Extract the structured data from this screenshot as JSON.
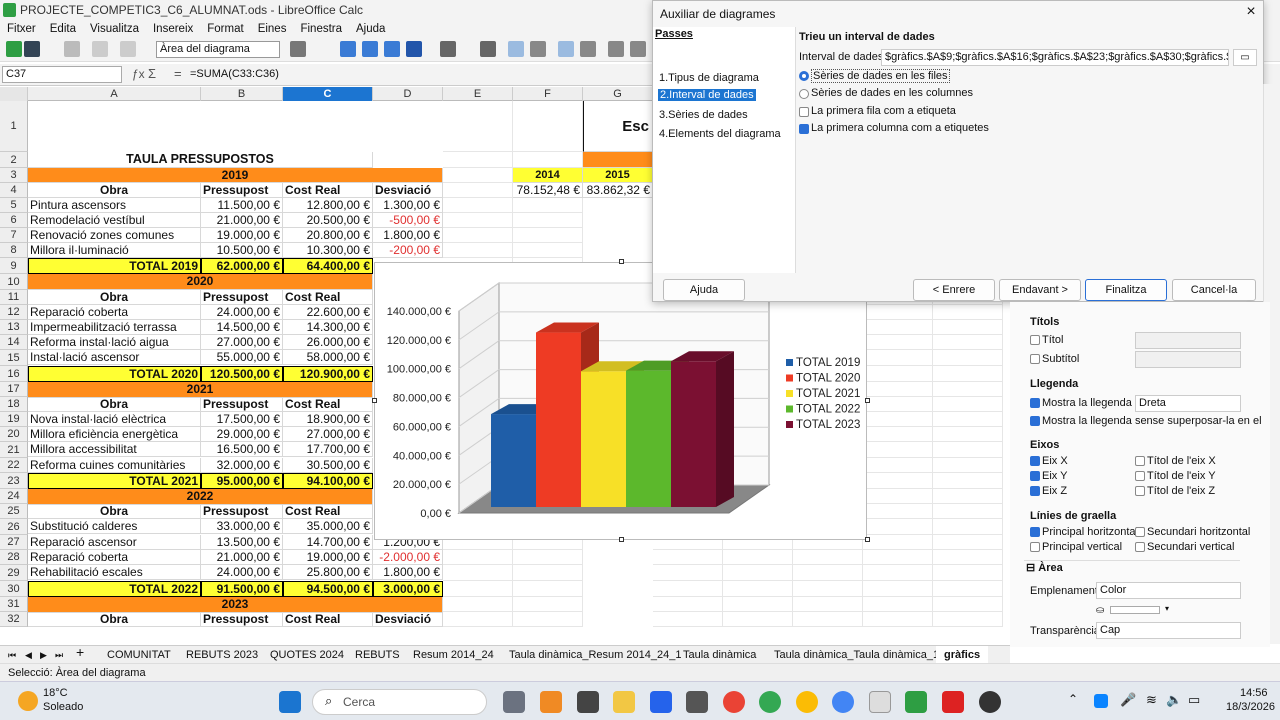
{
  "window": {
    "title": "PROJECTE_COMPETIC3_C6_ALUMNAT.ods - LibreOffice Calc"
  },
  "menu": [
    "Fitxer",
    "Edita",
    "Visualitza",
    "Insereix",
    "Format",
    "Eines",
    "Finestra",
    "Ajuda"
  ],
  "toolbar": {
    "object_select": "Àrea del diagrama"
  },
  "formula_bar": {
    "cell": "C37",
    "formula": "=SUMA(C33:C36)"
  },
  "columns": [
    "A",
    "B",
    "C",
    "D",
    "E",
    "F",
    "G"
  ],
  "rows": [
    "1",
    "2",
    "3",
    "4",
    "5",
    "6",
    "7",
    "8",
    "9",
    "10",
    "11",
    "12",
    "13",
    "14",
    "15",
    "16",
    "17",
    "18",
    "19",
    "20",
    "21",
    "22",
    "23",
    "24",
    "25",
    "26",
    "27",
    "28",
    "29",
    "30",
    "31",
    "32"
  ],
  "sheet": {
    "title": "TAULA PRESSUPOSTOS",
    "esc_fragment": "Esc",
    "yr_headers": [
      "2014",
      "2015"
    ],
    "yr_values": [
      "78.152,48 €",
      "83.862,32 €"
    ],
    "hdr_obra": "Obra",
    "hdr_pressupost": "Pressupost",
    "hdr_cost": "Cost Real",
    "hdr_desviacio": "Desviació",
    "y2019": "2019",
    "y2020": "2020",
    "y2021": "2021",
    "y2022": "2022",
    "y2023": "2023",
    "r5": [
      "Pintura ascensors",
      "11.500,00 €",
      "12.800,00 €",
      "1.300,00 €"
    ],
    "r6": [
      "Remodelació vestíbul",
      "21.000,00 €",
      "20.500,00 €",
      "-500,00 €"
    ],
    "r7": [
      "Renovació zones comunes",
      "19.000,00 €",
      "20.800,00 €",
      "1.800,00 €"
    ],
    "r8": [
      "Millora il·luminació",
      "10.500,00 €",
      "10.300,00 €",
      "-200,00 €"
    ],
    "r9": [
      "TOTAL 2019",
      "62.000,00 €",
      "64.400,00 €"
    ],
    "r12": [
      "Reparació coberta",
      "24.000,00 €",
      "22.600,00 €"
    ],
    "r13": [
      "Impermeabilització terrassa",
      "14.500,00 €",
      "14.300,00 €"
    ],
    "r14": [
      "Reforma instal·lació aigua",
      "27.000,00 €",
      "26.000,00 €"
    ],
    "r15": [
      "Instal·lació ascensor",
      "55.000,00 €",
      "58.000,00 €"
    ],
    "r16": [
      "TOTAL 2020",
      "120.500,00 €",
      "120.900,00 €"
    ],
    "r19": [
      "Nova instal·lació elèctrica",
      "17.500,00 €",
      "18.900,00 €"
    ],
    "r20": [
      "Millora eficiència energètica",
      "29.000,00 €",
      "27.000,00 €"
    ],
    "r21": [
      "Millora accessibilitat",
      "16.500,00 €",
      "17.700,00 €"
    ],
    "r22": [
      "Reforma cuines comunitàries",
      "32.000,00 €",
      "30.500,00 €"
    ],
    "r23": [
      "TOTAL 2021",
      "95.000,00 €",
      "94.100,00 €"
    ],
    "r26": [
      "Substitució calderes",
      "33.000,00 €",
      "35.000,00 €"
    ],
    "r27": [
      "Reparació ascensor",
      "13.500,00 €",
      "14.700,00 €",
      "1.200,00 €"
    ],
    "r28": [
      "Reparació coberta",
      "21.000,00 €",
      "19.000,00 €",
      "-2.000,00 €"
    ],
    "r29": [
      "Rehabilitació escales",
      "24.000,00 €",
      "25.800,00 €",
      "1.800,00 €"
    ],
    "r30": [
      "TOTAL 2022",
      "91.500,00 €",
      "94.500,00 €",
      "3.000,00 €"
    ]
  },
  "chart_data": {
    "type": "bar",
    "categories": [
      "TOTAL 2019",
      "TOTAL 2020",
      "TOTAL 2021",
      "TOTAL 2022",
      "TOTAL 2023"
    ],
    "values": [
      64400,
      120900,
      94100,
      94500,
      101000
    ],
    "colors": [
      "#1f5ea8",
      "#ee3b24",
      "#f7e027",
      "#5cb82c",
      "#7b1032"
    ],
    "ylim": [
      0,
      140000
    ],
    "yticks": [
      "0,00 €",
      "20.000,00 €",
      "40.000,00 €",
      "60.000,00 €",
      "80.000,00 €",
      "100.000,00 €",
      "120.000,00 €",
      "140.000,00 €"
    ],
    "legend": "right",
    "grid": true,
    "style": "3d"
  },
  "dialog": {
    "title": "Auxiliar de diagrames",
    "steps_title": "Passes",
    "steps": [
      "1.Tipus de diagrama",
      "2.Interval de dades",
      "3.Sèries de dades",
      "4.Elements del diagrama"
    ],
    "heading": "Trieu un interval de dades",
    "range_label": "Interval de dades:",
    "range_value": "$gràfics.$A$9;$gràfics.$A$16;$gràfics.$A$23;$gràfics.$A$30;$gràfics.$A$37;$grà",
    "radio_rows": "Sèries de dades en les files",
    "radio_cols": "Sèries de dades en les columnes",
    "chk_first_row": "La primera fila com a etiqueta",
    "chk_first_col": "La primera columna com a etiquetes",
    "btn_help": "Ajuda",
    "btn_back": "< Enrere",
    "btn_next": "Endavant >",
    "btn_finish": "Finalitza",
    "btn_cancel": "Cancel·la"
  },
  "sidebar": {
    "sec_titles": "Títols",
    "titol": "Títol",
    "subtitol": "Subtítol",
    "sec_legend": "Llegenda",
    "show_legend": "Mostra la llegenda",
    "legend_pos": "Dreta",
    "legend_nooverlap": "Mostra la llegenda sense superposar-la en el",
    "sec_axes": "Eixos",
    "ax_x": "Eix X",
    "ax_y": "Eix Y",
    "ax_z": "Eix Z",
    "t_x": "Títol de l'eix X",
    "t_y": "Títol de l'eix Y",
    "t_z": "Títol de l'eix Z",
    "sec_grid": "Línies de graella",
    "g_ph": "Principal horitzontal",
    "g_sh": "Secundari horitzontal",
    "g_pv": "Principal vertical",
    "g_sv": "Secundari vertical",
    "sec_area": "Àrea",
    "fill_label": "Emplenament:",
    "fill_value": "Color",
    "transp_label": "Transparència:",
    "transp_value": "Cap"
  },
  "tabs": [
    "COMUNITAT",
    "REBUTS 2023",
    "QUOTES 2024",
    "REBUTS",
    "Resum 2014_24",
    "Taula dinàmica_Resum 2014_24_1",
    "Taula dinàmica",
    "Taula dinàmica_Taula dinàmica_1",
    "gràfics"
  ],
  "status": "Selecció: Àrea del diagrama",
  "taskbar": {
    "temp": "18°C",
    "weather": "Soleado",
    "search": "Cerca",
    "time": "14:56",
    "date": "18/3/2026"
  }
}
